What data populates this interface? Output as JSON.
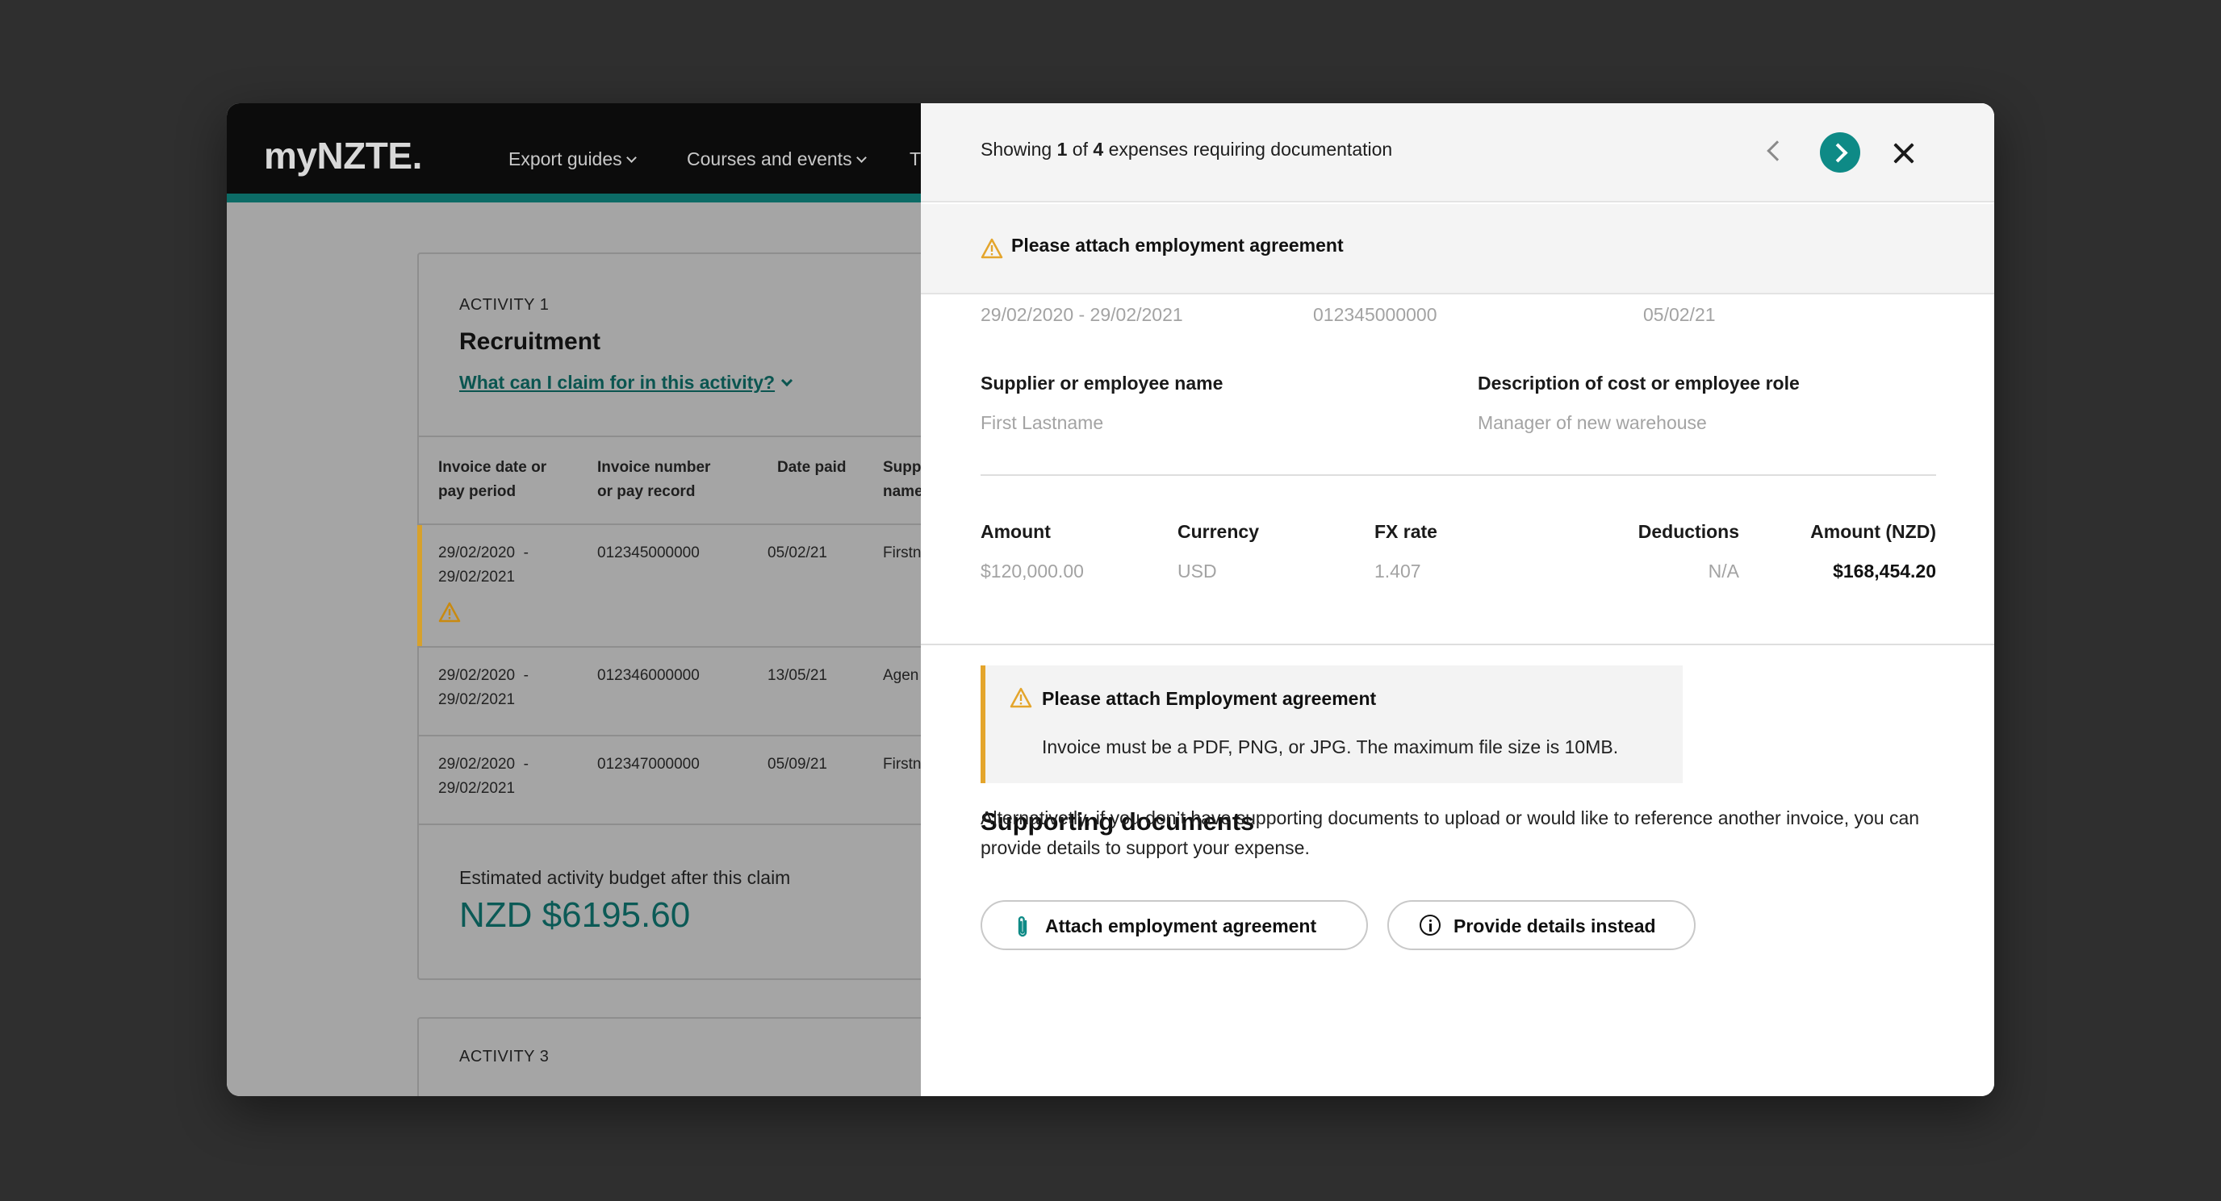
{
  "background": {
    "logo": "myNZTE.",
    "nav": [
      {
        "label": "Export guides"
      },
      {
        "label": "Courses and events"
      },
      {
        "label": "T"
      }
    ],
    "activity1": {
      "label": "ACTIVITY 1",
      "title": "Recruitment",
      "link": "What can I claim for in this activity?",
      "columns": [
        "Invoice date or\npay period",
        "Invoice number\nor pay record",
        "Date paid",
        "Supp\nname"
      ],
      "rows": [
        {
          "period": "29/02/2020  -\n29/02/2021",
          "invoice": "012345000000",
          "date": "05/02/21",
          "name": "Firstn",
          "flagged": true
        },
        {
          "period": "29/02/2020  -\n29/02/2021",
          "invoice": "012346000000",
          "date": "13/05/21",
          "name": "Agen",
          "flagged": false
        },
        {
          "period": "29/02/2020  -\n29/02/2021",
          "invoice": "012347000000",
          "date": "05/09/21",
          "name": "Firstn",
          "flagged": false
        }
      ],
      "budget_label": "Estimated activity budget after this claim",
      "budget_value": "NZD $6195.60"
    },
    "activity3": {
      "label": "ACTIVITY 3"
    }
  },
  "panel": {
    "showing_prefix": "Showing ",
    "showing_current": "1",
    "showing_of": " of ",
    "showing_total": "4",
    "showing_suffix": " expenses requiring documentation",
    "alert": "Please attach employment agreement",
    "period": "29/02/2020  -  29/02/2021",
    "invoice": "012345000000",
    "date_paid": "05/02/21",
    "supplier_label": "Supplier or employee name",
    "supplier_value": "First Lastname",
    "description_label": "Description of cost or employee role",
    "description_value": "Manager of new warehouse",
    "amount_label": "Amount",
    "amount_value": "$120,000.00",
    "currency_label": "Currency",
    "currency_value": "USD",
    "fx_label": "FX rate",
    "fx_value": "1.407",
    "deductions_label": "Deductions",
    "deductions_value": "N/A",
    "amount_nzd_label": "Amount (NZD)",
    "amount_nzd_value": "$168,454.20",
    "supporting_title": "Supporting documents",
    "doc_alert_title": "Please attach Employment agreement",
    "doc_alert_body": "Invoice must be a PDF, PNG, or JPG. The maximum file size is 10MB.",
    "alternative_text": "Alternativetly, if you don’t have supporting documents to upload or would like to reference another invoice, you can provide details to support your expense.",
    "attach_button": "Attach employment agreement",
    "details_button": "Provide details instead"
  },
  "colors": {
    "accent": "#0e8a86",
    "warning": "#e4a52c",
    "budget": "#0b5a56"
  }
}
